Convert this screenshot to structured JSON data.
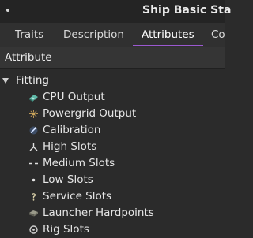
{
  "window": {
    "title": "Ship Basic Sta"
  },
  "tabs": [
    {
      "label": "Traits"
    },
    {
      "label": "Description"
    },
    {
      "label": "Attributes"
    },
    {
      "label": "Co"
    }
  ],
  "active_tab": "Attributes",
  "colors": {
    "accent": "#9b59d0",
    "background": "#2b2b2b"
  },
  "tree": {
    "column_header": "Attribute",
    "group": {
      "label": "Fitting",
      "items": [
        {
          "label": "CPU Output",
          "icon": "cpu-icon"
        },
        {
          "label": "Powergrid Output",
          "icon": "powergrid-icon"
        },
        {
          "label": "Calibration",
          "icon": "calibration-icon"
        },
        {
          "label": "High Slots",
          "icon": "high-slot-icon"
        },
        {
          "label": "Medium Slots",
          "icon": "medium-slot-icon"
        },
        {
          "label": "Low Slots",
          "icon": "low-slot-icon"
        },
        {
          "label": "Service Slots",
          "icon": "service-slot-icon"
        },
        {
          "label": "Launcher Hardpoints",
          "icon": "launcher-icon"
        },
        {
          "label": "Rig Slots",
          "icon": "rig-slot-icon"
        }
      ]
    }
  }
}
